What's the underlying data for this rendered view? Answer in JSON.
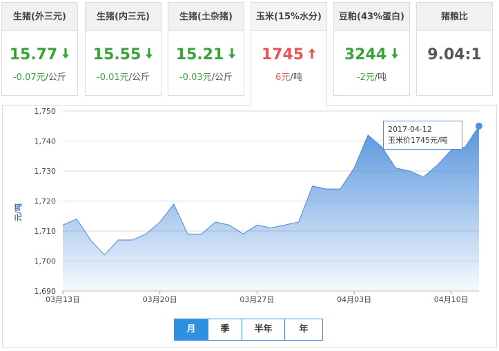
{
  "cards": [
    {
      "title": "生猪(外三元)",
      "price": "15.77",
      "direction": "down",
      "change_value": "-0.07元",
      "change_unit": "/公斤"
    },
    {
      "title": "生猪(内三元)",
      "price": "15.55",
      "direction": "down",
      "change_value": "-0.01元",
      "change_unit": "/公斤"
    },
    {
      "title": "生猪(土杂猪)",
      "price": "15.21",
      "direction": "down",
      "change_value": "-0.03元",
      "change_unit": "/公斤"
    },
    {
      "title": "玉米(15%水分)",
      "price": "1745",
      "direction": "up",
      "change_value": "6元",
      "change_unit": "/吨",
      "active": true
    },
    {
      "title": "豆粕(43%蛋白)",
      "price": "3244",
      "direction": "down",
      "change_value": "-2元",
      "change_unit": "/吨"
    },
    {
      "title": "猪粮比",
      "price": "9.04:1",
      "direction": "none",
      "change_value": "",
      "change_unit": ""
    }
  ],
  "colors": {
    "up": "#e85454",
    "down": "#3aa23a",
    "line": "#4a86d4",
    "fill_top": "#4f8fdc",
    "neutral": "#555555"
  },
  "icons": {
    "up": "arrow-up-icon",
    "down": "arrow-down-icon"
  },
  "tooltip": {
    "date": "2017-04-12",
    "text": "玉米价1745元/吨"
  },
  "range_buttons": [
    {
      "label": "月",
      "active": true
    },
    {
      "label": "季",
      "active": false
    },
    {
      "label": "半年",
      "active": false
    },
    {
      "label": "年",
      "active": false
    }
  ],
  "chart_data": {
    "type": "area",
    "ylabel": "元/吨",
    "ylim": [
      1690,
      1750
    ],
    "yticks": [
      1690,
      1700,
      1710,
      1720,
      1730,
      1740,
      1750
    ],
    "ytick_labels": [
      "1,690",
      "1,700",
      "1,710",
      "1,720",
      "1,730",
      "1,740",
      "1,750"
    ],
    "x_labels": [
      "03月13日",
      "03月20日",
      "03月27日",
      "04月03日",
      "04月10日"
    ],
    "x_label_index": [
      0,
      7,
      14,
      21,
      28
    ],
    "x_start": "03月13日",
    "x_end": "04月12日",
    "values": [
      1712,
      1714,
      1707,
      1702,
      1707,
      1707,
      1709,
      1713,
      1719,
      1709,
      1709,
      1713,
      1712,
      1709,
      1712,
      1711,
      1712,
      1713,
      1725,
      1724,
      1724,
      1731,
      1742,
      1738,
      1731,
      1730,
      1728,
      1732,
      1737,
      1738,
      1745
    ],
    "grid": true,
    "highlight_index": 30
  }
}
